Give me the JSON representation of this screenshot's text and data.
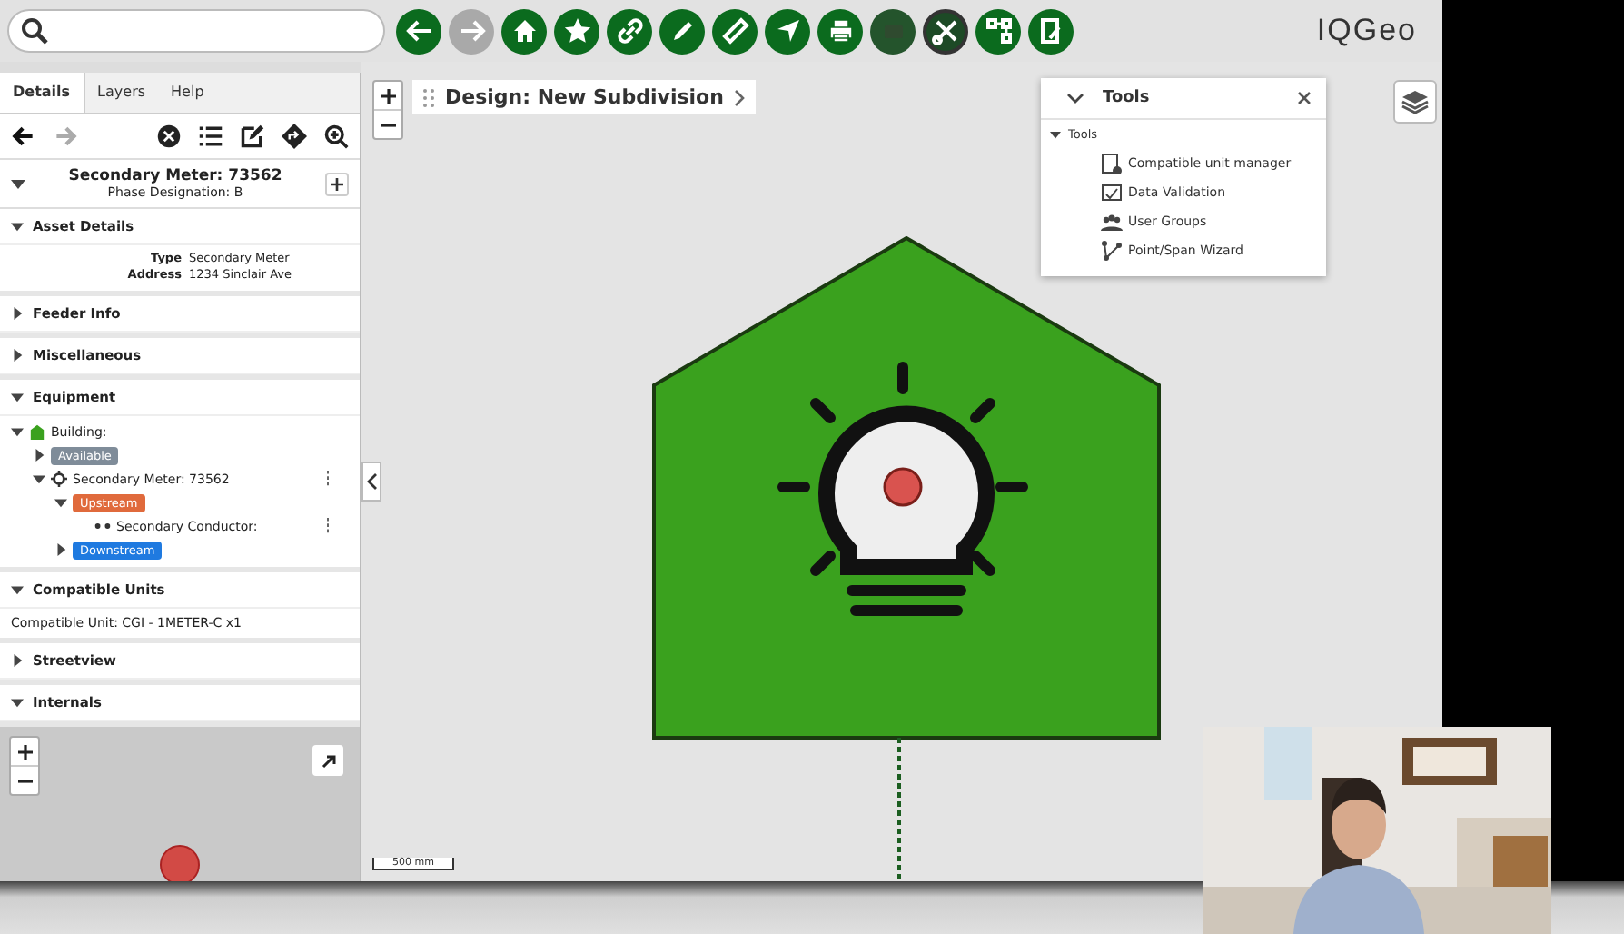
{
  "toolbar": [
    {
      "disabled": false,
      "selected": false
    },
    {
      "disabled": true,
      "selected": false
    },
    {
      "disabled": false,
      "selected": false
    },
    {
      "disabled": false,
      "selected": false
    },
    {
      "disabled": false,
      "selected": false
    },
    {
      "disabled": false,
      "selected": false
    },
    {
      "disabled": false,
      "selected": false
    },
    {
      "disabled": false,
      "selected": false
    },
    {
      "disabled": false,
      "selected": false
    },
    {
      "disabled": false,
      "selected": false
    },
    {
      "disabled": false,
      "selected": true
    },
    {
      "disabled": false,
      "selected": false
    },
    {
      "disabled": false,
      "selected": false
    }
  ],
  "logo": "IQGeo",
  "tabs": [
    {
      "label": "Details",
      "selected": true
    },
    {
      "label": "Layers",
      "selected": false
    },
    {
      "label": "Help",
      "selected": false
    }
  ],
  "details_toolbar": [
    {
      "disabled": false
    },
    {
      "disabled": true
    }
  ],
  "feature": {
    "title": "Secondary Meter: 73562",
    "subtitle": "Phase Designation: B"
  },
  "sections": [
    {
      "title": "Asset Details",
      "expanded": true,
      "fields": [
        {
          "label": "Type",
          "value": "Secondary Meter"
        },
        {
          "label": "Address",
          "value": "1234 Sinclair Ave"
        }
      ]
    },
    {
      "title": "Feeder Info",
      "expanded": false
    },
    {
      "title": "Miscellaneous",
      "expanded": false
    },
    {
      "title": "Equipment",
      "expanded": true,
      "tree": [
        {
          "kind": "building",
          "label": "Building:",
          "expanded": true,
          "children": [
            {
              "kind": "tag",
              "label": "Available",
              "color": "#7f8c99",
              "expanded": false
            },
            {
              "kind": "meter",
              "label": "Secondary Meter: 73562",
              "expanded": true,
              "menu": true,
              "children": [
                {
                  "kind": "tag",
                  "label": "Upstream",
                  "color": "#e06a3c",
                  "expanded": true,
                  "children": [
                    {
                      "kind": "conductor",
                      "label": "Secondary Conductor:",
                      "menu": true
                    }
                  ]
                },
                {
                  "kind": "tag",
                  "label": "Downstream",
                  "color": "#1f7ae0",
                  "expanded": false
                }
              ]
            }
          ]
        }
      ]
    },
    {
      "title": "Compatible Units",
      "expanded": true,
      "text": "Compatible Unit: CGI - 1METER-C x1"
    },
    {
      "title": "Streetview",
      "expanded": false
    },
    {
      "title": "Internals",
      "expanded": true
    }
  ],
  "design": {
    "title": "Design: New Subdivision"
  },
  "tools_panel": {
    "title": "Tools",
    "group": "Tools",
    "expanded": true,
    "items": [
      {
        "kind": "units",
        "label": "Compatible unit manager"
      },
      {
        "kind": "validation",
        "label": "Data Validation"
      },
      {
        "kind": "groups",
        "label": "User Groups"
      },
      {
        "kind": "wizard",
        "label": "Point/Span Wizard"
      }
    ]
  },
  "scale": "500 mm"
}
